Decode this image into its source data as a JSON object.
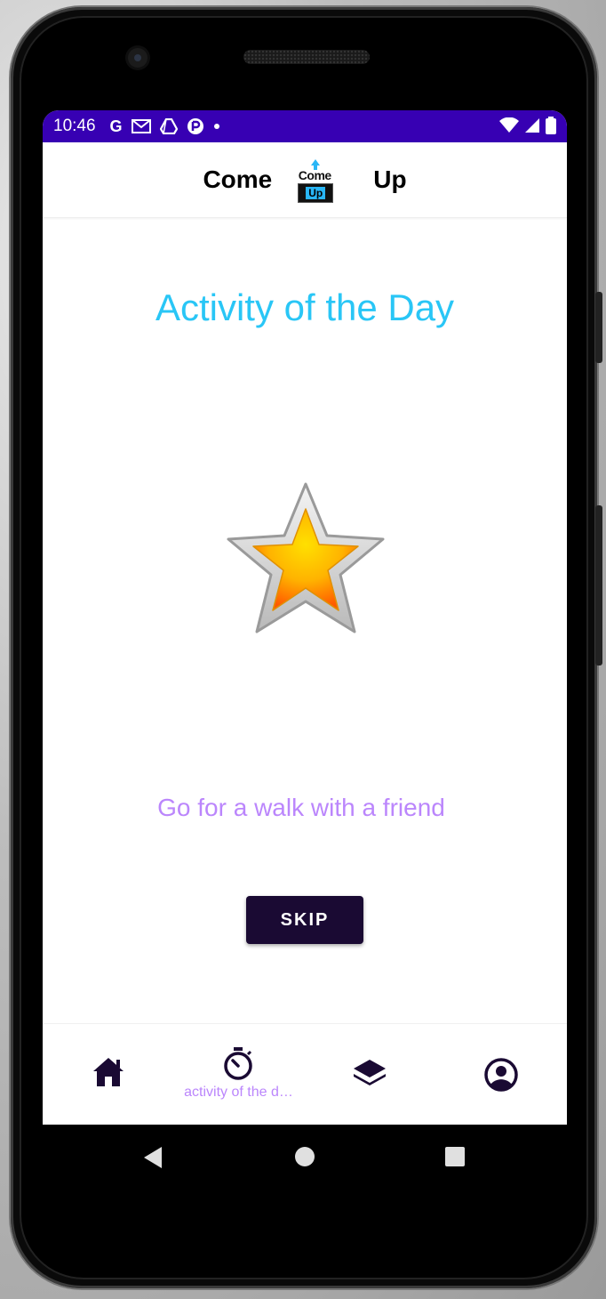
{
  "status_bar": {
    "time": "10:46",
    "notification_icons": [
      "google-g-icon",
      "gmail-icon",
      "drive-icon",
      "app-icon",
      "dot-icon"
    ],
    "right_icons": [
      "wifi-icon",
      "signal-icon",
      "battery-icon"
    ],
    "bg_color": "#3700b3"
  },
  "app_bar": {
    "title_left": "Come",
    "logo_top": "Come",
    "logo_bottom": "Up",
    "title_right": "Up"
  },
  "main": {
    "title": "Activity of the Day",
    "activity_text": "Go for a walk with a friend",
    "skip_label": "SKIP",
    "title_color": "#29c6f6",
    "accent_color": "#bb86fc",
    "button_color": "#1a0a33"
  },
  "bottom_nav": {
    "items": [
      {
        "icon": "home-icon",
        "label": ""
      },
      {
        "icon": "stopwatch-icon",
        "label": "activity of the d…"
      },
      {
        "icon": "layers-icon",
        "label": ""
      },
      {
        "icon": "profile-icon",
        "label": ""
      }
    ]
  },
  "system_nav": [
    "back-icon",
    "home-circle-icon",
    "recents-icon"
  ]
}
